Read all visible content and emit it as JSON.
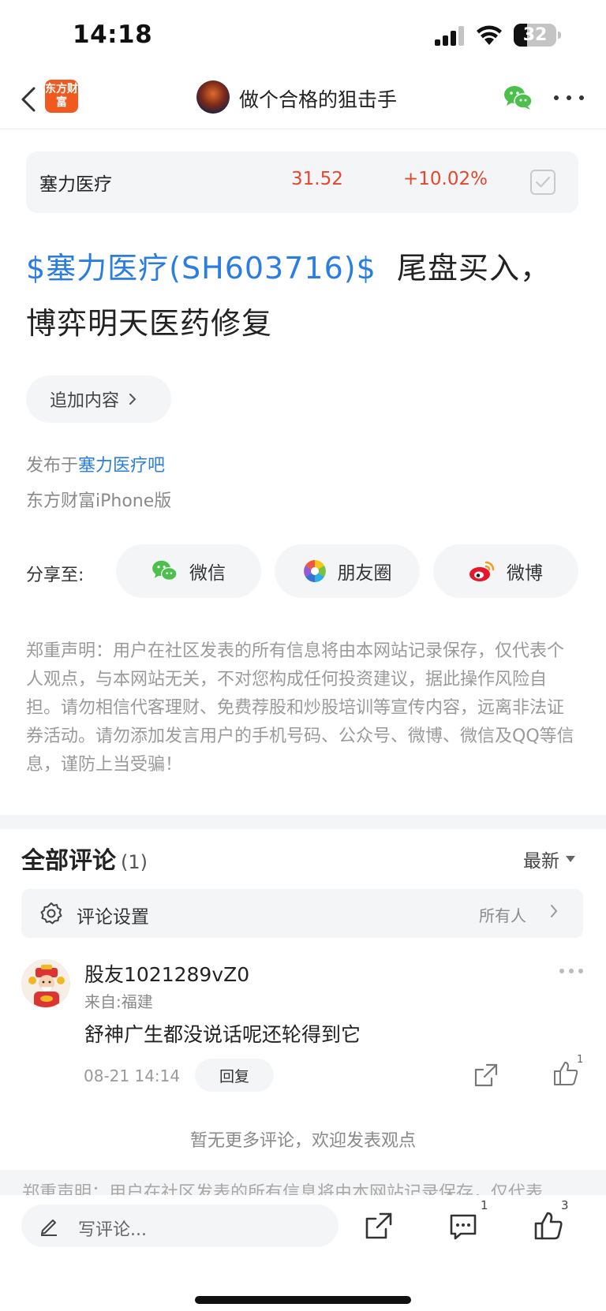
{
  "status_bar": {
    "time": "14:18",
    "battery": "32",
    "battery_level": 0.32
  },
  "nav": {
    "logo_text": "东方财富",
    "title": "做个合格的狙击手"
  },
  "stock": {
    "name": "塞力医疗",
    "price": "31.52",
    "change": "+10.02%"
  },
  "post": {
    "stock_tag": "$塞力医疗(SH603716)$",
    "title_text": "尾盘买入，博弈明天医药修复",
    "append_label": "追加内容",
    "posted_prefix": "发布于",
    "forum_name": "塞力医疗吧",
    "device": "东方财富iPhone版"
  },
  "share": {
    "label": "分享至:",
    "options": [
      {
        "label": "微信",
        "icon": "wechat-icon"
      },
      {
        "label": "朋友圈",
        "icon": "moments-icon"
      },
      {
        "label": "微博",
        "icon": "weibo-icon"
      }
    ]
  },
  "disclaimer": "郑重声明：用户在社区发表的所有信息将由本网站记录保存，仅代表个人观点，与本网站无关，不对您构成任何投资建议，据此操作风险自担。请勿相信代客理财、免费荐股和炒股培训等宣传内容，远离非法证券活动。请勿添加发言用户的手机号码、公众号、微博、微信及QQ等信息，谨防上当受骗！",
  "comments": {
    "header": "全部评论",
    "count": "(1)",
    "sort": "最新",
    "settings_label": "评论设置",
    "settings_value": "所有人",
    "items": [
      {
        "username": "股友1021289vZ0",
        "location": "来自:福建",
        "text": "舒神广生都没说话呢还轮得到它",
        "time": "08-21 14:14",
        "reply_label": "回复",
        "likes": "1"
      }
    ],
    "no_more": "暂无更多评论，欢迎发表观点"
  },
  "bottom_bar": {
    "ghost_text": "郑重声明：用户在社区发表的所有信息将由本网站记录保存，仅代表",
    "write_placeholder": "写评论...",
    "comment_count": "1",
    "like_count": "3"
  },
  "colors": {
    "accent_blue": "#2a7de1",
    "price_red": "#e4472d",
    "brand_orange": "#f05a1f",
    "wechat_green": "#4cbf4c"
  }
}
